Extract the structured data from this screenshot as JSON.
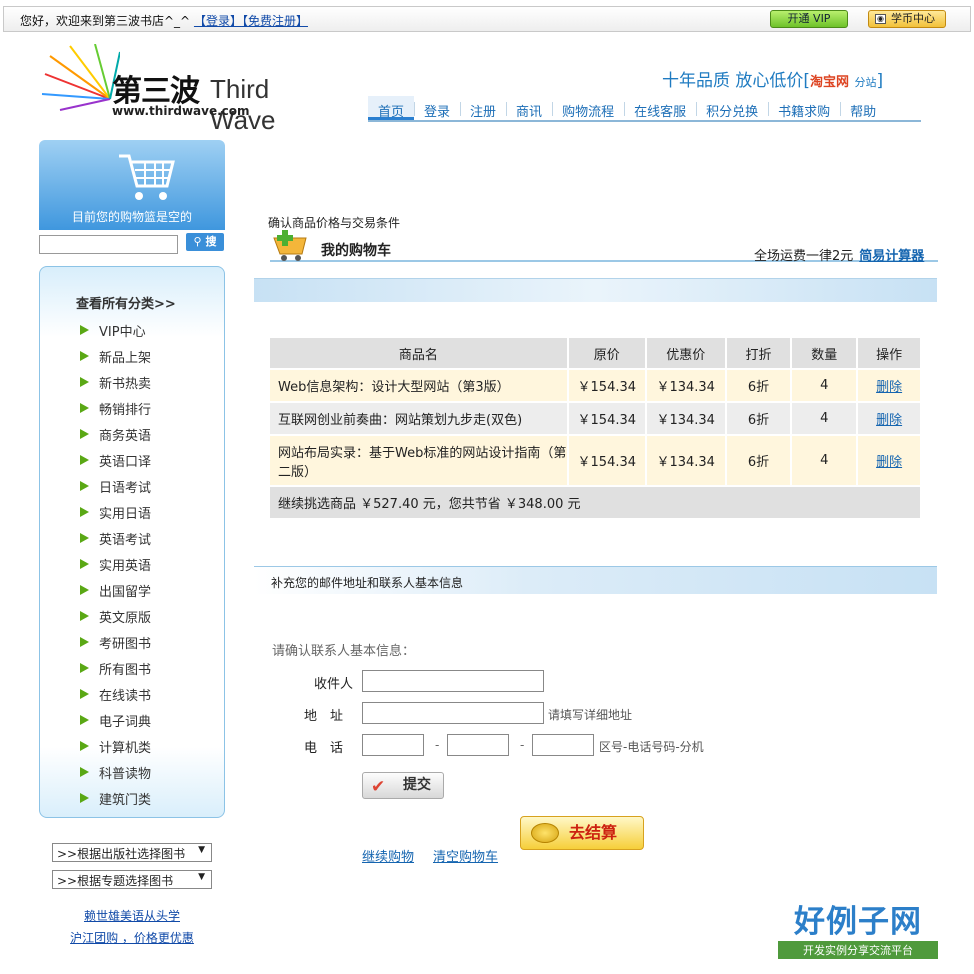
{
  "topbar": {
    "greeting": "您好，欢迎来到第三波书店^_^",
    "login": "【登录】",
    "register": "【免费注册】",
    "vip_button": "开通 VIP",
    "coin_button": "学币中心"
  },
  "logo": {
    "cn": "第三波",
    "en": "Third Wave",
    "url": "www.thirdwave.com"
  },
  "slogan": {
    "text": "十年品质 放心低价",
    "taobao": "淘宝网",
    "branch": "分站"
  },
  "nav": [
    "首页",
    "登录",
    "注册",
    "商讯",
    "购物流程",
    "在线客服",
    "积分兑换",
    "书籍求购",
    "帮助"
  ],
  "sidebar": {
    "cart_status": "目前您的购物篮是空的",
    "search_button": "搜",
    "categories_title": "查看所有分类>>",
    "categories": [
      "VIP中心",
      "新品上架",
      "新书热卖",
      "畅销排行",
      "商务英语",
      "英语口译",
      "日语考试",
      "实用日语",
      "英语考试",
      "实用英语",
      "出国留学",
      "英文原版",
      "考研图书",
      "所有图书",
      "在线读书",
      "电子词典",
      "计算机类",
      "科普读物",
      "建筑门类"
    ],
    "select_publisher": ">>根据出版社选择图书",
    "select_topic": ">>根据专题选择图书",
    "link1": "赖世雄美语从头学",
    "link2": "沪江团购 ，价格更优惠"
  },
  "main": {
    "confirm_title": "确认商品价格与交易条件",
    "cart_title": "我的购物车",
    "shipping": "全场运费一律2元",
    "calculator": "简易计算器",
    "table_headers": [
      "商品名",
      "原价",
      "优惠价",
      "打折",
      "数量",
      "操作"
    ],
    "rows": [
      {
        "name": "Web信息架构：设计大型网站（第3版）",
        "price": "￥154.34",
        "sale": "￥134.34",
        "discount": "6折",
        "qty": "4",
        "action": "删除"
      },
      {
        "name": "互联网创业前奏曲：网站策划九步走(双色)",
        "price": "￥154.34",
        "sale": "￥134.34",
        "discount": "6折",
        "qty": "4",
        "action": "删除"
      },
      {
        "name": "网站布局实录：基于Web标准的网站设计指南（第二版）",
        "price": "￥154.34",
        "sale": "￥134.34",
        "discount": "6折",
        "qty": "4",
        "action": "删除"
      }
    ],
    "summary": "继续挑选商品 ￥527.40 元，您共节省 ￥348.00 元",
    "section_title": "补充您的邮件地址和联系人基本信息",
    "contact_title": "请确认联系人基本信息：",
    "label_receiver": "收件人",
    "label_address": "地　址",
    "label_phone": "电　话",
    "address_hint": "请填写详细地址",
    "phone_hint": "区号-电话号码-分机",
    "phone_dash": "-",
    "submit": "提交",
    "checkout": "去结算",
    "continue": "继续购物",
    "clear": "清空购物车"
  },
  "watermark": {
    "brand": "好例子网",
    "tagline": "开发实例分享交流平台"
  }
}
